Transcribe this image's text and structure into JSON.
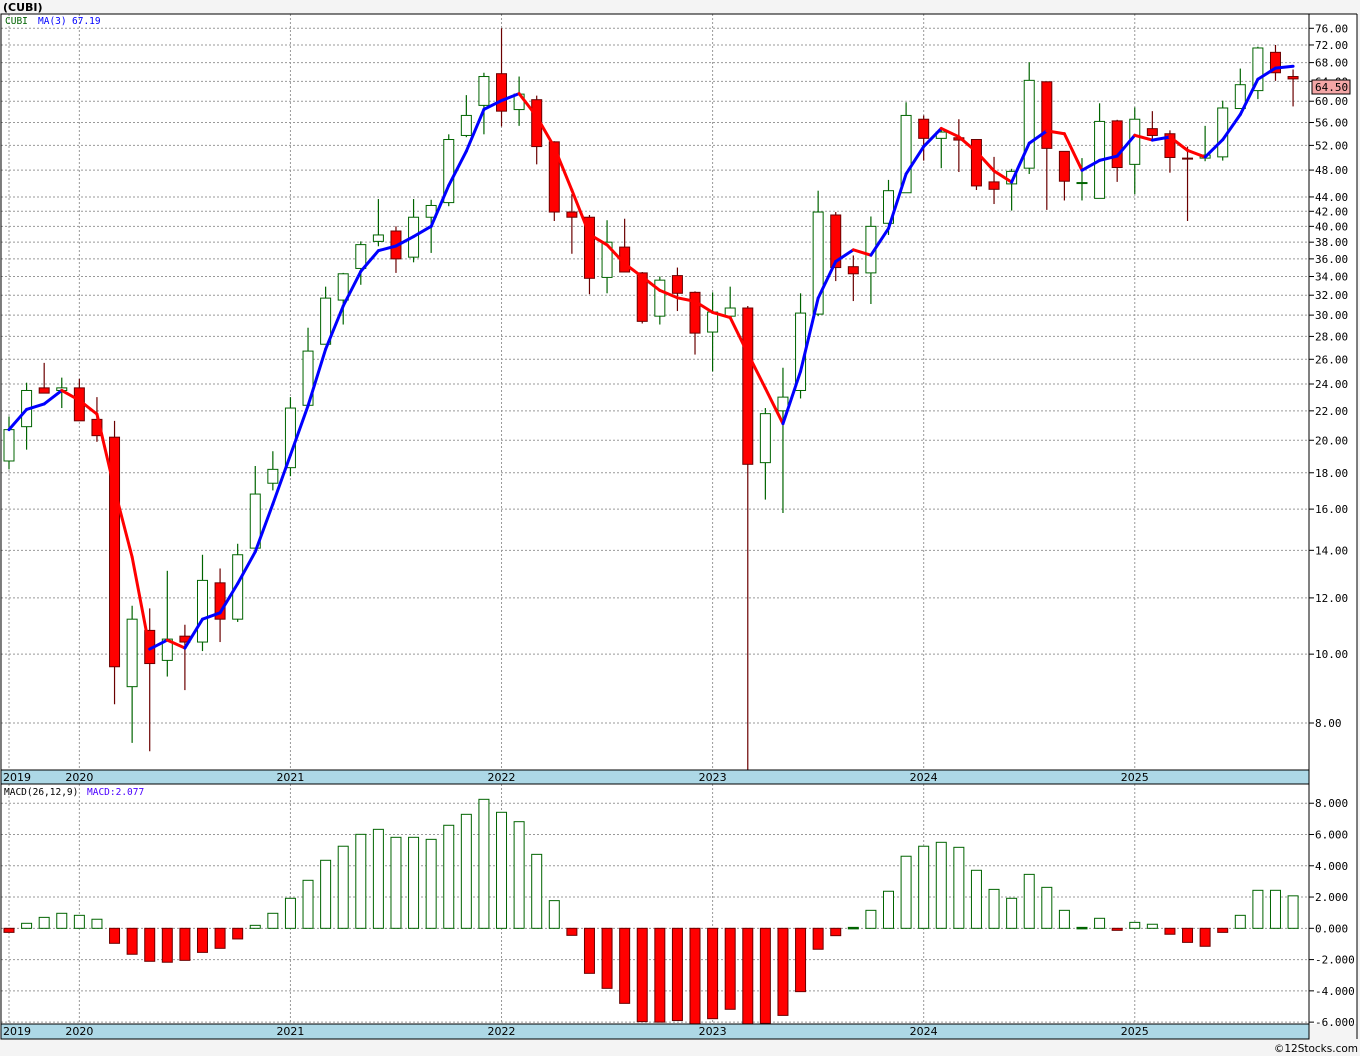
{
  "title": "(CUBI)",
  "legend": {
    "symbol": "CUBI",
    "ma_label": "MA(3)",
    "ma_value": "67.19"
  },
  "last_price_label": "64.50",
  "macd_legend": {
    "label": "MACD(26,12,9)",
    "value": "MACD:2.077"
  },
  "copyright": "©12Stocks.com",
  "colors": {
    "up": "#006400",
    "down": "#ff0000",
    "wick_down": "#6b0000",
    "ma_up": "#0000ff",
    "ma_down": "#ff0000",
    "date_bar": "#add8e6",
    "last_price_bg": "#f4a6a6",
    "symbol": "#006400",
    "ma_text": "#0000ff",
    "macd_value_text": "#4b00ff"
  },
  "year_labels": [
    "2019",
    "2020",
    "2021",
    "2022",
    "2023",
    "2024",
    "2025"
  ],
  "chart_data": [
    {
      "type": "candlestick",
      "yscale": "log",
      "ylim": [
        6.87,
        79.6
      ],
      "grid": true,
      "overlay": "MA(3)",
      "y_ticks": [
        "76.00",
        "72.00",
        "68.00",
        "64.00",
        "60.00",
        "56.00",
        "52.00",
        "48.00",
        "44.00",
        "42.00",
        "40.00",
        "38.00",
        "36.00",
        "34.00",
        "32.00",
        "30.00",
        "28.00",
        "26.00",
        "24.00",
        "22.00",
        "20.00",
        "18.00",
        "16.00",
        "14.00",
        "12.00",
        "10.00",
        "8.00"
      ],
      "start_month": "2019-09",
      "ohlc": [
        [
          18.7,
          21.6,
          18.2,
          20.7
        ],
        [
          20.9,
          24.1,
          19.4,
          23.5
        ],
        [
          23.7,
          25.7,
          23.3,
          23.3
        ],
        [
          23.5,
          24.5,
          22.2,
          23.7
        ],
        [
          23.7,
          24.4,
          21.3,
          21.3
        ],
        [
          21.4,
          23.0,
          19.9,
          20.3
        ],
        [
          20.2,
          21.3,
          8.5,
          9.6
        ],
        [
          9.0,
          11.7,
          7.5,
          11.2
        ],
        [
          10.8,
          11.6,
          7.3,
          9.7
        ],
        [
          9.8,
          13.1,
          9.3,
          10.5
        ],
        [
          10.6,
          11.0,
          8.9,
          10.4
        ],
        [
          10.4,
          13.8,
          10.1,
          12.7
        ],
        [
          12.6,
          13.2,
          10.4,
          11.2
        ],
        [
          11.2,
          14.3,
          11.1,
          13.8
        ],
        [
          14.1,
          18.4,
          14.1,
          16.8
        ],
        [
          17.4,
          19.3,
          17.0,
          18.2
        ],
        [
          18.3,
          23.0,
          17.8,
          22.2
        ],
        [
          22.4,
          28.8,
          22.4,
          26.7
        ],
        [
          27.3,
          32.9,
          27.3,
          31.7
        ],
        [
          31.5,
          34.4,
          29.1,
          34.3
        ],
        [
          34.9,
          38.1,
          33.1,
          37.7
        ],
        [
          38.1,
          43.7,
          37.5,
          38.9
        ],
        [
          39.4,
          40.0,
          34.4,
          36.0
        ],
        [
          36.2,
          43.7,
          35.6,
          41.2
        ],
        [
          41.2,
          43.6,
          36.7,
          42.8
        ],
        [
          43.2,
          53.9,
          42.7,
          53.0
        ],
        [
          53.7,
          61.2,
          53.4,
          57.3
        ],
        [
          59.2,
          65.8,
          53.9,
          65.0
        ],
        [
          65.6,
          76.0,
          55.3,
          58.1
        ],
        [
          58.4,
          65.0,
          55.4,
          61.4
        ],
        [
          60.3,
          61.1,
          48.9,
          51.8
        ],
        [
          52.6,
          52.7,
          40.7,
          41.9
        ],
        [
          41.9,
          44.4,
          36.6,
          41.2
        ],
        [
          41.2,
          41.5,
          32.1,
          33.8
        ],
        [
          33.9,
          40.8,
          32.2,
          38.0
        ],
        [
          37.4,
          41.0,
          34.5,
          34.5
        ],
        [
          34.4,
          34.5,
          29.2,
          29.4
        ],
        [
          29.9,
          34.0,
          29.1,
          33.6
        ],
        [
          34.1,
          35.0,
          30.4,
          32.2
        ],
        [
          32.3,
          32.4,
          26.4,
          28.3
        ],
        [
          28.4,
          32.3,
          25.0,
          30.3
        ],
        [
          29.9,
          32.9,
          29.8,
          30.7
        ],
        [
          30.7,
          30.9,
          6.5,
          18.5
        ],
        [
          18.6,
          22.2,
          16.5,
          21.8
        ],
        [
          22.0,
          25.3,
          15.8,
          23.0
        ],
        [
          23.5,
          32.2,
          22.9,
          30.2
        ],
        [
          30.1,
          44.9,
          29.9,
          41.9
        ],
        [
          41.5,
          41.9,
          33.5,
          35.0
        ],
        [
          35.1,
          36.4,
          31.4,
          34.3
        ],
        [
          34.4,
          41.3,
          31.1,
          40.0
        ],
        [
          40.4,
          46.5,
          38.9,
          44.9
        ],
        [
          44.6,
          59.8,
          44.6,
          57.3
        ],
        [
          56.6,
          57.3,
          49.5,
          53.2
        ],
        [
          53.2,
          54.8,
          48.3,
          54.3
        ],
        [
          53.3,
          56.6,
          47.7,
          52.9
        ],
        [
          53.0,
          53.0,
          45.0,
          45.6
        ],
        [
          46.2,
          50.1,
          43.0,
          45.1
        ],
        [
          45.9,
          48.2,
          42.1,
          47.8
        ],
        [
          48.3,
          68.1,
          47.4,
          64.2
        ],
        [
          63.9,
          63.9,
          42.2,
          51.5
        ],
        [
          51.0,
          51.0,
          43.5,
          46.3
        ],
        [
          46.0,
          49.9,
          43.5,
          46.1
        ],
        [
          43.8,
          59.6,
          43.8,
          56.2
        ],
        [
          56.3,
          56.5,
          46.2,
          48.4
        ],
        [
          48.9,
          58.8,
          44.4,
          56.6
        ],
        [
          54.9,
          58.1,
          53.0,
          53.7
        ],
        [
          54.0,
          54.6,
          47.6,
          50.0
        ],
        [
          49.9,
          51.8,
          40.7,
          49.8
        ],
        [
          49.9,
          55.4,
          49.4,
          50.4
        ],
        [
          50.1,
          60.1,
          49.5,
          58.7
        ],
        [
          58.6,
          66.7,
          58.6,
          63.3
        ],
        [
          62.1,
          71.6,
          60.4,
          71.3
        ],
        [
          70.3,
          72.0,
          64.1,
          65.8
        ],
        [
          65.0,
          66.5,
          59.0,
          64.5
        ]
      ]
    },
    {
      "type": "bar",
      "title": "MACD(26,12,9)",
      "ylim": [
        -6.12,
        9.23
      ],
      "grid": true,
      "y_ticks": [
        "8.000",
        "6.000",
        "4.000",
        "2.000",
        "0.000",
        "-2.000",
        "-4.000",
        "-6.000"
      ],
      "start_month": "2019-09",
      "values": [
        -0.26,
        0.32,
        0.7,
        0.96,
        0.83,
        0.58,
        -0.96,
        -1.66,
        -2.11,
        -2.17,
        -2.05,
        -1.54,
        -1.28,
        -0.68,
        0.19,
        0.96,
        1.92,
        3.07,
        4.35,
        5.25,
        6.01,
        6.33,
        5.82,
        5.82,
        5.69,
        6.59,
        7.29,
        8.25,
        7.42,
        6.82,
        4.73,
        1.77,
        -0.45,
        -2.88,
        -3.84,
        -4.8,
        -5.97,
        -6.0,
        -5.9,
        -6.14,
        -5.78,
        -5.18,
        -6.2,
        -6.08,
        -5.57,
        -4.05,
        -1.34,
        -0.47,
        0.06,
        1.15,
        2.37,
        4.61,
        5.25,
        5.5,
        5.18,
        3.71,
        2.49,
        1.92,
        3.45,
        2.62,
        1.15,
        0.06,
        0.64,
        -0.13,
        0.38,
        0.26,
        -0.38,
        -0.9,
        -1.15,
        -0.26,
        0.83,
        2.43,
        2.43,
        2.077
      ]
    }
  ]
}
